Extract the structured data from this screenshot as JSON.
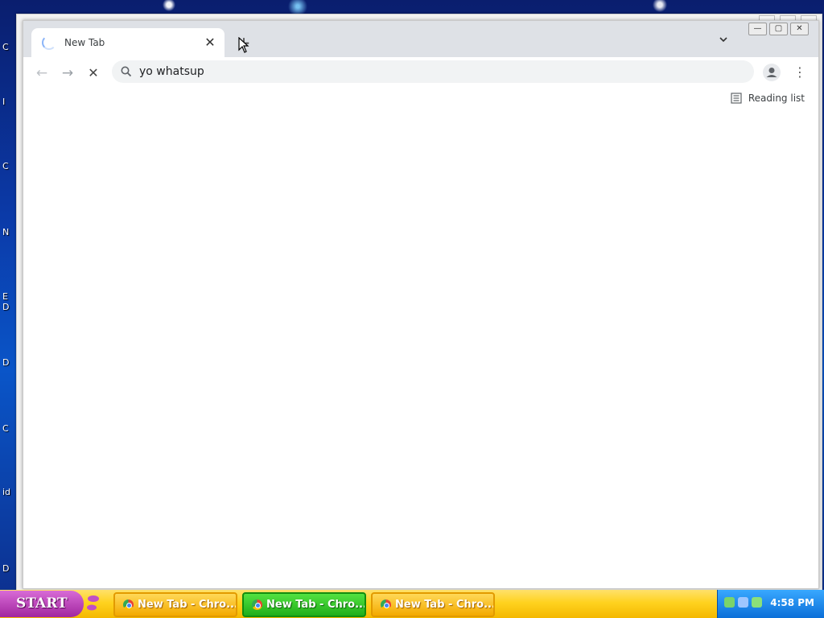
{
  "desktop": {
    "edge_labels": [
      "C",
      "I",
      "C",
      "N",
      "E",
      "D",
      "D",
      "C",
      "id",
      "D"
    ]
  },
  "browser": {
    "tab": {
      "title": "New Tab",
      "close_label": "✕"
    },
    "new_tab_label": "+",
    "tab_search_label": "⌄",
    "window_controls": {
      "minimize": "—",
      "maximize": "▢",
      "close": "✕"
    },
    "toolbar": {
      "back": "←",
      "forward": "→",
      "stop": "✕",
      "address_value": "yo whatsup",
      "menu": "⋮"
    },
    "bookmarks_bar": {
      "reading_list_label": "Reading list"
    }
  },
  "taskbar": {
    "start_label": "START",
    "tasks": [
      {
        "label": "New Tab - Chro...",
        "active": false
      },
      {
        "label": "New Tab - Chro...",
        "active": true
      },
      {
        "label": "New Tab - Chro...",
        "active": false
      }
    ],
    "clock": "4:58 PM"
  },
  "colors": {
    "titlebar": "#dee1e6",
    "omnibox": "#f1f3f4",
    "taskbar": "#ffd21f",
    "task_active": "#1fae1a",
    "start": "#a1269f",
    "tray": "#0b6fd8"
  }
}
